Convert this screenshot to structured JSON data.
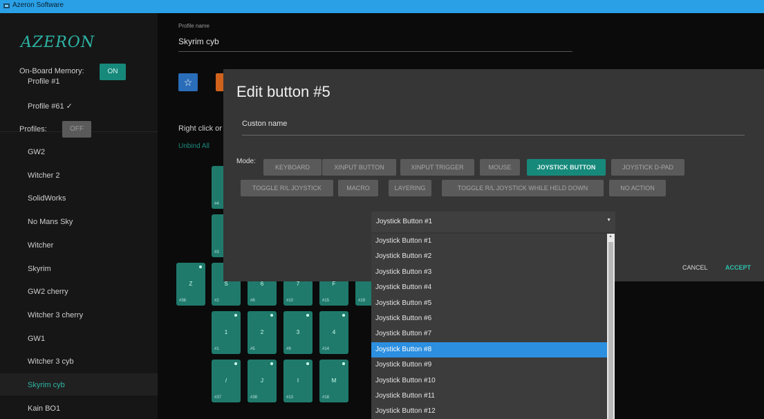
{
  "window": {
    "title": "Azeron Software"
  },
  "sidebar": {
    "logo": "AZERON",
    "onboard_label": "On-Board Memory:",
    "onboard_toggle": "ON",
    "memory_profiles": [
      "Profile #1",
      "Profile #61 ✓"
    ],
    "profiles_label": "Profiles:",
    "profiles_toggle": "OFF",
    "profiles": [
      "GW2",
      "Witcher 2",
      "SolidWorks",
      "No Mans Sky",
      "Witcher",
      "Skyrim",
      "GW2 cherry",
      "Witcher 3 cherry",
      "GW1",
      "Witcher 3 cyb",
      "Skyrim cyb",
      "Kain BO1"
    ],
    "selected_profile": "Skyrim cyb"
  },
  "main": {
    "profile_name_label": "Profile name",
    "profile_name_value": "Skyrim cyb",
    "star": "☆",
    "right_click_text": "Right click or",
    "unbind_all": "Unbind All",
    "key_grid": [
      [
        {
          "label": "",
          "num": "#4"
        }
      ],
      [
        {
          "label": "",
          "num": "#3"
        }
      ],
      [
        {
          "label": "Z",
          "num": "#36"
        },
        {
          "label": "S",
          "num": "#2"
        },
        {
          "label": "6",
          "num": "#6"
        },
        {
          "label": "7",
          "num": "#10"
        },
        {
          "label": "F",
          "num": "#15"
        },
        {
          "label": "",
          "num": "#19"
        }
      ],
      [
        {
          "label": "1",
          "num": "#1"
        },
        {
          "label": "2",
          "num": "#5"
        },
        {
          "label": "3",
          "num": "#9"
        },
        {
          "label": "4",
          "num": "#14"
        }
      ],
      [
        {
          "label": "/",
          "num": "#37"
        },
        {
          "label": "J",
          "num": "#38"
        },
        {
          "label": "I",
          "num": "#13"
        },
        {
          "label": "M",
          "num": "#18"
        }
      ]
    ]
  },
  "modal": {
    "title": "Edit button #5",
    "custom_name_label": "Custon name",
    "mode_label": "Mode:",
    "modes": [
      "KEYBOARD",
      "XINPUT BUTTON",
      "XINPUT TRIGGER",
      "MOUSE",
      "JOYSTICK BUTTON",
      "JOYSTICK D-PAD",
      "TOGGLE R/L JOYSTICK",
      "MACRO",
      "LAYERING",
      "TOGGLE R/L JOYSTICK WHILE HELD DOWN",
      "NO ACTION"
    ],
    "active_mode": "JOYSTICK BUTTON",
    "cancel": "CANCEL",
    "accept": "ACCEPT"
  },
  "select": {
    "value": "Joystick Button #1",
    "arrow": "▼",
    "options": [
      "Joystick Button #1",
      "Joystick Button #2",
      "Joystick Button #3",
      "Joystick Button #4",
      "Joystick Button #5",
      "Joystick Button #6",
      "Joystick Button #7",
      "Joystick Button #8",
      "Joystick Button #9",
      "Joystick Button #10",
      "Joystick Button #11",
      "Joystick Button #12"
    ],
    "highlighted": "Joystick Button #8"
  },
  "colors": {
    "accent": "#17897b",
    "titlebar": "#2aa0e6",
    "highlight": "#2c8fe0",
    "star_button": "#2a6db8",
    "orange_button": "#d0621c"
  }
}
